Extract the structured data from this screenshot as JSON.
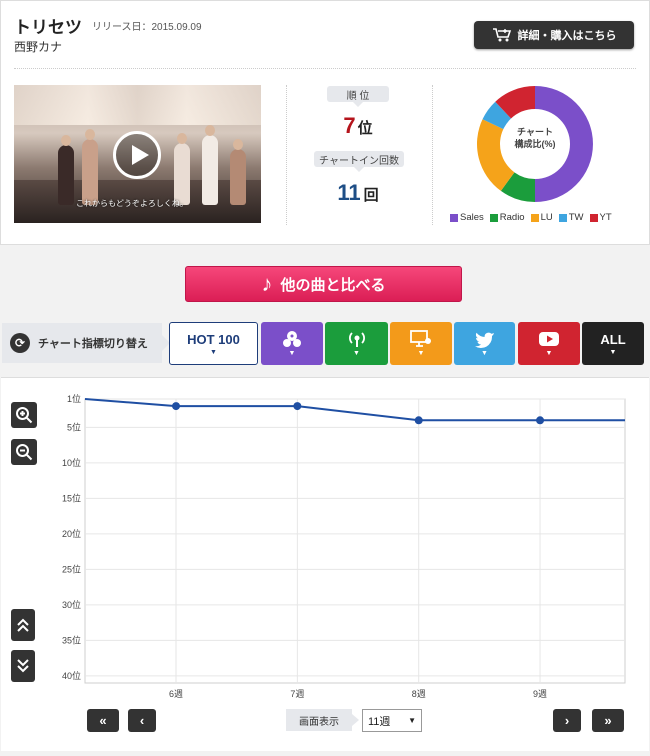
{
  "song": {
    "title": "トリセツ",
    "release": "リリース日：2015.09.09",
    "artist": "西野カナ",
    "buy_label": "詳細・購入はこちら"
  },
  "video": {
    "subtitle": "これからもどうぞよろしくね。"
  },
  "stats": {
    "rank_label": "順 位",
    "rank_value": "7",
    "rank_unit": "位",
    "weeks_label": "チャートイン回数",
    "weeks_value": "11",
    "weeks_unit": "回"
  },
  "composition": {
    "label_line1": "チャート",
    "label_line2": "構成比(%)",
    "legend": [
      {
        "name": "Sales",
        "color": "#7b4fc9"
      },
      {
        "name": "Radio",
        "color": "#1b9d3c"
      },
      {
        "name": "LU",
        "color": "#f5a31a"
      },
      {
        "name": "TW",
        "color": "#3ea5e0"
      },
      {
        "name": "YT",
        "color": "#d02430"
      }
    ],
    "shares": [
      50,
      10,
      22,
      6,
      12
    ]
  },
  "compare": {
    "label": "他の曲と比べる"
  },
  "switch": {
    "label": "チャート指標切り替え",
    "tabs": {
      "hot100": "HOT 100",
      "all": "ALL"
    }
  },
  "chart_data": {
    "type": "line",
    "y_tick_labels": [
      "1位",
      "5位",
      "10位",
      "15位",
      "20位",
      "25位",
      "30位",
      "35位",
      "40位"
    ],
    "y_ticks": [
      1,
      5,
      10,
      15,
      20,
      25,
      30,
      35,
      40
    ],
    "ylim": [
      1,
      41
    ],
    "y_inverted": true,
    "x_tick_labels": [
      "6週",
      "7週",
      "8週",
      "9週"
    ],
    "x_ticks": [
      6,
      7,
      8,
      9
    ],
    "xlim": [
      5.25,
      9.7
    ],
    "series": [
      {
        "color": "#1f4fa3",
        "points": [
          [
            5.25,
            1
          ],
          [
            6,
            2
          ],
          [
            7,
            2
          ],
          [
            8,
            4
          ],
          [
            9,
            4
          ],
          [
            9.7,
            4
          ]
        ]
      }
    ],
    "grid": true
  },
  "pager": {
    "display_label": "画面表示",
    "selected": "11週"
  }
}
